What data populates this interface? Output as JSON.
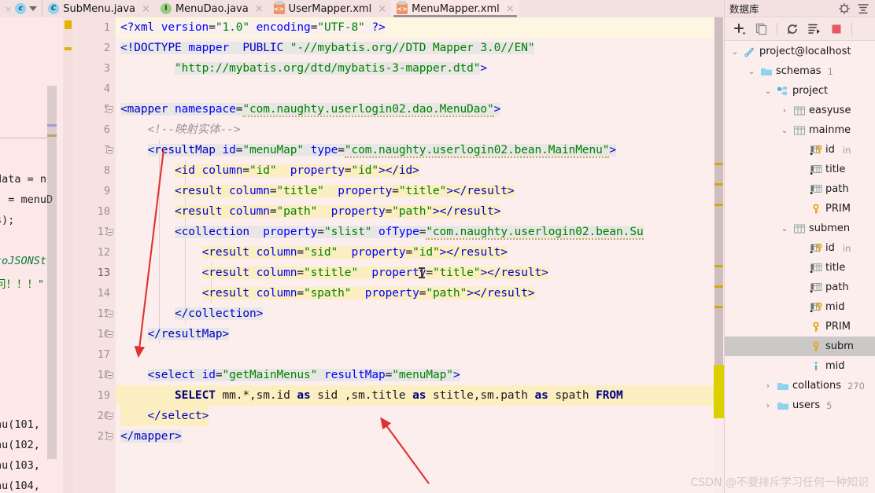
{
  "tabs": {
    "lead_close_label": "×",
    "lead_icon": "class-icon",
    "lead_chevron": "chevron-down-icon",
    "items": [
      {
        "label": "SubMenu.java",
        "icon": "java-class-icon",
        "icon_glyph": "C",
        "close": "×",
        "active": false
      },
      {
        "label": "MenuDao.java",
        "icon": "java-interface-icon",
        "icon_glyph": "I",
        "close": "×",
        "active": false
      },
      {
        "label": "UserMapper.xml",
        "icon": "xml-file-icon",
        "icon_glyph": "<>",
        "close": "×",
        "active": false
      },
      {
        "label": "MenuMapper.xml",
        "icon": "xml-file-icon",
        "icon_glyph": "<>",
        "close": "×",
        "active": true
      }
    ]
  },
  "editor": {
    "file": "MenuMapper.xml",
    "line_numbers": [
      "1",
      "2",
      "3",
      "4",
      "5",
      "6",
      "7",
      "8",
      "9",
      "10",
      "11",
      "12",
      "13",
      "14",
      "15",
      "16",
      "17",
      "18",
      "19",
      "20",
      "21"
    ],
    "lines": [
      {
        "n": "1",
        "text": "<?xml version=\"1.0\" encoding=\"UTF-8\" ?>"
      },
      {
        "n": "2",
        "text": "<!DOCTYPE mapper  PUBLIC \"-//mybatis.org//DTD Mapper 3.0//EN\""
      },
      {
        "n": "3",
        "text": "        \"http://mybatis.org/dtd/mybatis-3-mapper.dtd\">"
      },
      {
        "n": "4",
        "text": ""
      },
      {
        "n": "5",
        "text": "<mapper namespace=\"com.naughty.userlogin02.dao.MenuDao\">"
      },
      {
        "n": "6",
        "text": "    <!--映射实体-->"
      },
      {
        "n": "7",
        "text": "    <resultMap id=\"menuMap\" type=\"com.naughty.userlogin02.bean.MainMenu\">"
      },
      {
        "n": "8",
        "text": "        <id column=\"id\"  property=\"id\"></id>"
      },
      {
        "n": "9",
        "text": "        <result column=\"title\"  property=\"title\"></result>"
      },
      {
        "n": "10",
        "text": "        <result column=\"path\"  property=\"path\"></result>"
      },
      {
        "n": "11",
        "text": "        <collection  property=\"slist\" ofType=\"com.naughty.userlogin02.bean.Su"
      },
      {
        "n": "12",
        "text": "            <result column=\"sid\"  property=\"id\"></result>"
      },
      {
        "n": "13",
        "text": "            <result column=\"stitle\"  property=\"title\"></result>"
      },
      {
        "n": "14",
        "text": "            <result column=\"spath\"  property=\"path\"></result>"
      },
      {
        "n": "15",
        "text": "        </collection>"
      },
      {
        "n": "16",
        "text": "    </resultMap>"
      },
      {
        "n": "17",
        "text": ""
      },
      {
        "n": "18",
        "text": "    <select id=\"getMainMenus\" resultMap=\"menuMap\">"
      },
      {
        "n": "19",
        "text": "        SELECT mm.*,sm.id as sid ,sm.title as stitle,sm.path as spath FROM "
      },
      {
        "n": "20",
        "text": "    </select>"
      },
      {
        "n": "21",
        "text": "</mapper>"
      }
    ]
  },
  "left_editor": {
    "fragments": [
      "data = n",
      "  = menuD",
      "s);",
      "toJSONSt",
      "问！！！\"",
      "nu(101,",
      "nu(102,",
      "nu(103,",
      "nu(104,"
    ]
  },
  "db_panel": {
    "title": "数据库",
    "header_icons": [
      "settings-icon",
      "collapse-all-icon"
    ],
    "toolbar_icons": [
      "add-icon",
      "copy-icon",
      "refresh-icon",
      "run-query-icon",
      "stop-icon"
    ],
    "tree": [
      {
        "label": "project@localhost",
        "icon": "datasource-icon",
        "twist": "⌄",
        "indent": 0,
        "count": "",
        "sub": "",
        "selected": false
      },
      {
        "label": "schemas",
        "icon": "folder-icon",
        "twist": "⌄",
        "indent": 1,
        "count": "1",
        "sub": "",
        "selected": false
      },
      {
        "label": "project",
        "icon": "schema-icon",
        "twist": "⌄",
        "indent": 2,
        "count": "",
        "sub": "",
        "selected": false
      },
      {
        "label": "easyuse",
        "icon": "table-icon",
        "twist": "›",
        "indent": 3,
        "count": "",
        "sub": "",
        "selected": false
      },
      {
        "label": "mainme",
        "icon": "table-icon",
        "twist": "⌄",
        "indent": 3,
        "count": "",
        "sub": "",
        "selected": false
      },
      {
        "label": "id",
        "icon": "column-key-icon",
        "twist": "",
        "indent": 4,
        "count": "",
        "sub": "in",
        "selected": false
      },
      {
        "label": "title",
        "icon": "column-icon",
        "twist": "",
        "indent": 4,
        "count": "",
        "sub": "",
        "selected": false
      },
      {
        "label": "path",
        "icon": "column-icon",
        "twist": "",
        "indent": 4,
        "count": "",
        "sub": "",
        "selected": false
      },
      {
        "label": "PRIM",
        "icon": "key-icon",
        "twist": "",
        "indent": 4,
        "count": "",
        "sub": "",
        "selected": false
      },
      {
        "label": "submen",
        "icon": "table-icon",
        "twist": "⌄",
        "indent": 3,
        "count": "",
        "sub": "",
        "selected": false
      },
      {
        "label": "id",
        "icon": "column-key-icon",
        "twist": "",
        "indent": 4,
        "count": "",
        "sub": "in",
        "selected": false
      },
      {
        "label": "title",
        "icon": "column-icon",
        "twist": "",
        "indent": 4,
        "count": "",
        "sub": "",
        "selected": false
      },
      {
        "label": "path",
        "icon": "column-icon",
        "twist": "",
        "indent": 4,
        "count": "",
        "sub": "",
        "selected": false
      },
      {
        "label": "mid",
        "icon": "column-key-icon",
        "twist": "",
        "indent": 4,
        "count": "",
        "sub": "",
        "selected": false
      },
      {
        "label": "PRIM",
        "icon": "key-icon",
        "twist": "",
        "indent": 4,
        "count": "",
        "sub": "",
        "selected": false
      },
      {
        "label": "subm",
        "icon": "key-icon",
        "twist": "",
        "indent": 4,
        "count": "",
        "sub": "",
        "selected": true
      },
      {
        "label": "mid",
        "icon": "info-icon",
        "twist": "",
        "indent": 4,
        "count": "",
        "sub": "",
        "selected": false
      },
      {
        "label": "collations",
        "icon": "folder-icon",
        "twist": "›",
        "indent": 2,
        "count": "270",
        "sub": "",
        "selected": false
      },
      {
        "label": "users",
        "icon": "folder-icon",
        "twist": "›",
        "indent": 2,
        "count": "5",
        "sub": "",
        "selected": false
      }
    ]
  },
  "watermark": {
    "text": "CSDN @不要排斥学习任何一种知识"
  },
  "colors": {
    "background": "#fdeeee",
    "tabbar": "#f3e0e1",
    "gutter": "#f7e2e2",
    "tag": "#0000c8",
    "attr": "#0000ff",
    "string": "#008000",
    "comment": "#9b9398",
    "highlight_yellow": "#fbeec0",
    "annotation_arrow": "#e03131",
    "selection": "#cdc8c8"
  }
}
